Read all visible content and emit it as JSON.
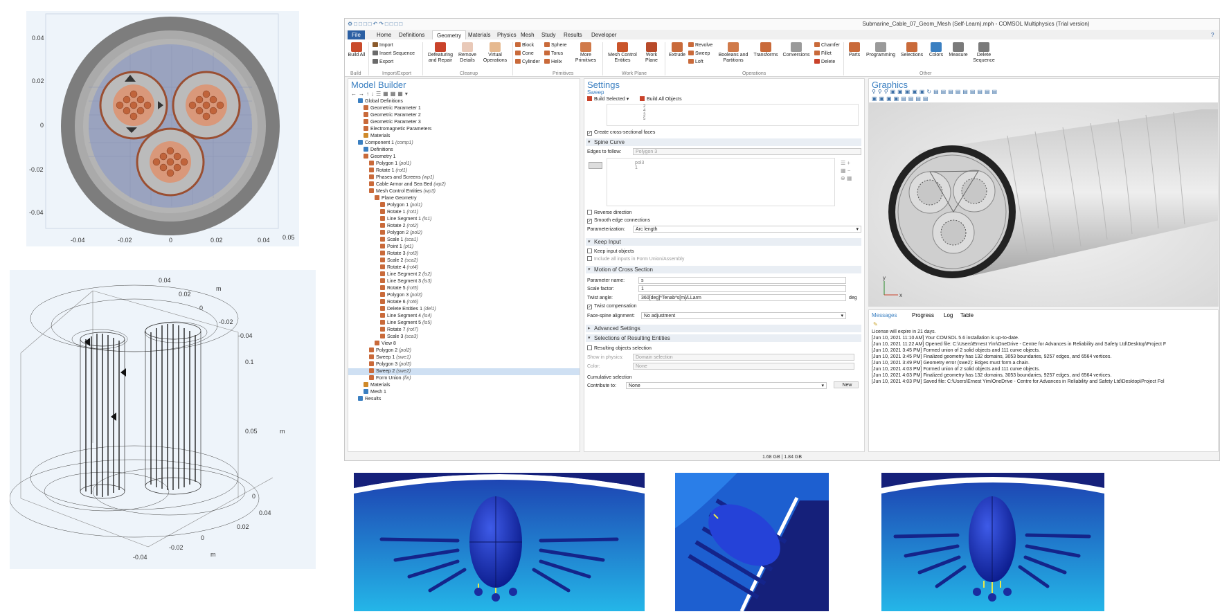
{
  "cross_section": {
    "y_ticks": [
      "0.04",
      "0.02",
      "0",
      "-0.02",
      "-0.04"
    ],
    "x_ticks": [
      "-0.04",
      "-0.02",
      "0",
      "0.02",
      "0.04",
      "0.05"
    ]
  },
  "wireframe": {
    "top_ticks": [
      "0.04",
      "0.02",
      "0",
      "-0.02",
      "-0.04"
    ],
    "z_ticks": [
      "0.1",
      "0.05",
      "0"
    ],
    "bottom_ticks": [
      "0.04",
      "0.02",
      "0",
      "-0.02",
      "-0.04"
    ],
    "unit": "m"
  },
  "window": {
    "title": "Submarine_Cable_07_Geom_Mesh (Self-Learn).mph - COMSOL Multiphysics (Trial version)",
    "tabs": [
      "File",
      "Home",
      "Definitions",
      "Geometry",
      "Materials",
      "Physics",
      "Mesh",
      "Study",
      "Results",
      "Developer"
    ],
    "ribbon": {
      "build_all": "Build All",
      "import": "Import",
      "insert_sequence": "Insert Sequence",
      "export": "Export",
      "defeaturing": "Defeaturing and Repair",
      "remove_details": "Remove Details",
      "virtual_operations": "Virtual Operations",
      "block": "Block",
      "cone": "Cone",
      "cylinder": "Cylinder",
      "sphere": "Sphere",
      "torus": "Torus",
      "helix": "Helix",
      "more_primitives": "More Primitives",
      "mesh_control": "Mesh Control Entities",
      "work_plane": "Work Plane",
      "extrude": "Extrude",
      "revolve": "Revolve",
      "sweep": "Sweep",
      "loft": "Loft",
      "booleans": "Booleans and Partitions",
      "transforms": "Transforms",
      "conversions": "Conversions",
      "chamfer": "Chamfer",
      "fillet": "Fillet",
      "delete": "Delete",
      "parts": "Parts",
      "programming": "Programming",
      "selections": "Selections",
      "colors": "Colors",
      "measure": "Measure",
      "delete_sequence": "Delete Sequence",
      "groups": [
        "Build",
        "Import/Export",
        "Cleanup",
        "Primitives",
        "Work Plane",
        "Operations",
        "Other"
      ]
    },
    "model_builder": {
      "title": "Model Builder",
      "items": [
        {
          "label": "Global Definitions",
          "tag": ""
        },
        {
          "label": "Geometric Parameter 1",
          "tag": ""
        },
        {
          "label": "Geometric Parameter 2",
          "tag": ""
        },
        {
          "label": "Geometric Parameter 3",
          "tag": ""
        },
        {
          "label": "Electromagnetic Parameters",
          "tag": ""
        },
        {
          "label": "Materials",
          "tag": ""
        },
        {
          "label": "Component 1",
          "tag": "(comp1)"
        },
        {
          "label": "Definitions",
          "tag": ""
        },
        {
          "label": "Geometry 1",
          "tag": ""
        },
        {
          "label": "Polygon 1",
          "tag": "(pol1)"
        },
        {
          "label": "Rotate 1",
          "tag": "(rot1)"
        },
        {
          "label": "Phases and Screens",
          "tag": "(wp1)"
        },
        {
          "label": "Cable Armor and Sea Bed",
          "tag": "(wp2)"
        },
        {
          "label": "Mesh Control Entities",
          "tag": "(wp3)"
        },
        {
          "label": "Plane Geometry",
          "tag": ""
        },
        {
          "label": "Polygon 1",
          "tag": "(pol1)"
        },
        {
          "label": "Rotate 1",
          "tag": "(rot1)"
        },
        {
          "label": "Line Segment 1",
          "tag": "(ls1)"
        },
        {
          "label": "Rotate 2",
          "tag": "(rot2)"
        },
        {
          "label": "Polygon 2",
          "tag": "(pol2)"
        },
        {
          "label": "Scale 1",
          "tag": "(sca1)"
        },
        {
          "label": "Point 1",
          "tag": "(pt1)"
        },
        {
          "label": "Rotate 3",
          "tag": "(rot3)"
        },
        {
          "label": "Scale 2",
          "tag": "(sca2)"
        },
        {
          "label": "Rotate 4",
          "tag": "(rot4)"
        },
        {
          "label": "Line Segment 2",
          "tag": "(ls2)"
        },
        {
          "label": "Line Segment 3",
          "tag": "(ls3)"
        },
        {
          "label": "Rotate 5",
          "tag": "(rot5)"
        },
        {
          "label": "Polygon 3",
          "tag": "(pol3)"
        },
        {
          "label": "Rotate 6",
          "tag": "(rot6)"
        },
        {
          "label": "Delete Entities 1",
          "tag": "(del1)"
        },
        {
          "label": "Line Segment 4",
          "tag": "(ls4)"
        },
        {
          "label": "Line Segment 5",
          "tag": "(ls5)"
        },
        {
          "label": "Rotate 7",
          "tag": "(rot7)"
        },
        {
          "label": "Scale 3",
          "tag": "(sca3)"
        },
        {
          "label": "View 8",
          "tag": ""
        },
        {
          "label": "Polygon 2",
          "tag": "(pol2)"
        },
        {
          "label": "Sweep 1",
          "tag": "(swe1)"
        },
        {
          "label": "Polygon 3",
          "tag": "(pol3)"
        },
        {
          "label": "Sweep 2",
          "tag": "(swe2)"
        },
        {
          "label": "Form Union",
          "tag": "(fin)"
        },
        {
          "label": "Materials",
          "tag": ""
        },
        {
          "label": "Mesh 1",
          "tag": ""
        },
        {
          "label": "Results",
          "tag": ""
        }
      ]
    },
    "settings": {
      "title": "Settings",
      "subtitle": "Sweep",
      "build_selected": "Build Selected",
      "build_all": "Build All Objects",
      "list_nums": [
        "2",
        "4",
        "3",
        "5"
      ],
      "create_cross": "Create cross-sectional faces",
      "spine_curve": "Spine Curve",
      "edges_to_follow": "Edges to follow:",
      "edges_value": "Polygon 3",
      "edge_item": "pol3",
      "edge_item_n": "1",
      "reverse": "Reverse direction",
      "smooth": "Smooth edge connections",
      "parameterization": "Parameterization:",
      "param_value": "Arc length",
      "keep_input": "Keep Input",
      "keep_input_objects": "Keep input objects",
      "include_all": "Include all inputs in Form Union/Assembly",
      "motion": "Motion of Cross Section",
      "param_name": "Parameter name:",
      "param_name_val": "s",
      "scale_factor": "Scale factor:",
      "scale_val": "1",
      "twist": "Twist angle:",
      "twist_val": "360[deg]*Tenab*s[m]/LLarm",
      "twist_unit": "deg",
      "twist_comp": "Twist compensation",
      "face_spine": "Face-spine alignment:",
      "face_spine_val": "No adjustment",
      "advanced": "Advanced Settings",
      "selections": "Selections of Resulting Entities",
      "resulting": "Resulting objects selection",
      "show_physics": "Show in physics:",
      "show_physics_val": "Domain selection",
      "color": "Color:",
      "color_val": "None",
      "cumulative": "Cumulative selection",
      "contribute": "Contribute to:",
      "contribute_val": "None",
      "new": "New"
    },
    "graphics_title": "Graphics",
    "axis_y": "y",
    "axis_x": "x",
    "messages": {
      "tabs": [
        "Messages",
        "Progress",
        "Log",
        "Table"
      ],
      "lines": [
        "License will expire in 21 days.",
        "[Jun 10, 2021 11:10 AM] Your COMSOL 5.6 installation is up-to-date.",
        "[Jun 10, 2021 11:22 AM] Opened file: C:\\Users\\Ernest Yim\\OneDrive - Centre for Advances in Reliability and Safety Ltd\\Desktop\\Project F",
        "[Jun 10, 2021 3:45 PM] Formed union of 2 solid objects and 111 curve objects.",
        "[Jun 10, 2021 3:45 PM] Finalized geometry has 132 domains, 3053 boundaries, 9257 edges, and 6564 vertices.",
        "[Jun 10, 2021 3:49 PM] Geometry error (swe2): Edges must form a chain.",
        "[Jun 10, 2021 4:03 PM] Formed union of 2 solid objects and 111 curve objects.",
        "[Jun 10, 2021 4:03 PM] Finalized geometry has 132 domains, 3053 boundaries, 9257 edges, and 6564 vertices.",
        "[Jun 10, 2021 4:03 PM] Saved file: C:\\Users\\Ernest Yim\\OneDrive - Centre for Advances in Reliability and Safety Ltd\\Desktop\\Project Fol"
      ]
    },
    "status": "1.68 GB | 1.84 GB"
  }
}
